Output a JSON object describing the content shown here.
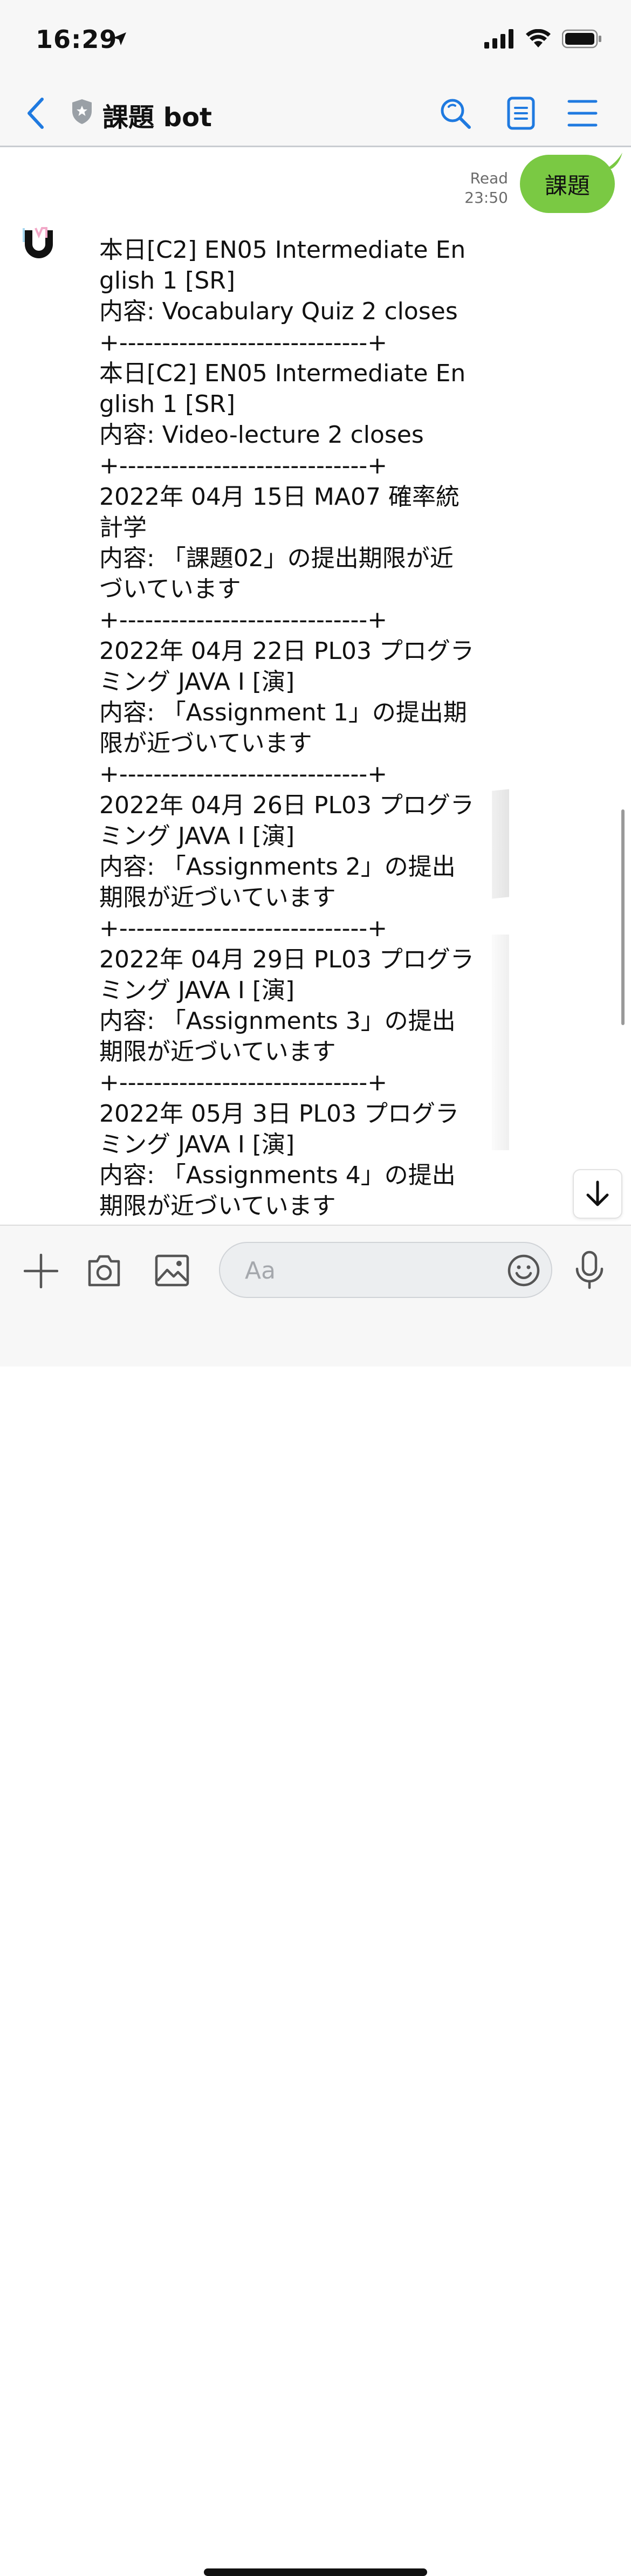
{
  "status_bar": {
    "time": "16:29"
  },
  "header": {
    "title": "課題 bot",
    "icons": [
      "back-icon",
      "shield-icon",
      "search-icon",
      "notes-icon",
      "menu-icon"
    ]
  },
  "chat": {
    "outgoing": {
      "text": "課題",
      "read_label": "Read",
      "time": "23:50"
    },
    "bot_message": "本日[C2] EN05 Intermediate English 1 [SR]\n内容: Vocabulary Quiz 2 closes\n+-----------------------------+\n本日[C2] EN05 Intermediate English 1 [SR]\n内容: Video-lecture 2 closes\n+-----------------------------+\n2022年 04月 15日 MA07 確率統計学\n内容: 「課題02」の提出期限が近づいています\n+-----------------------------+\n2022年 04月 22日 PL03 プログラミング JAVA I [演]\n内容: 「Assignment 1」の提出期限が近づいています\n+-----------------------------+\n2022年 04月 26日 PL03 プログラミング JAVA I [演]\n内容: 「Assignments 2」の提出期限が近づいています\n+-----------------------------+\n2022年 04月 29日 PL03 プログラミング JAVA I [演]\n内容: 「Assignments 3」の提出期限が近づいています\n+-----------------------------+\n2022年 05月 3日 PL03 プログラミング JAVA I [演]\n内容: 「Assignments 4」の提出期限が近づいています"
  },
  "input_bar": {
    "placeholder": "Aa"
  },
  "colors": {
    "accent": "#1f7ae0",
    "bubble_green": "#7ac943",
    "bar_bg": "#f7f7f7"
  }
}
